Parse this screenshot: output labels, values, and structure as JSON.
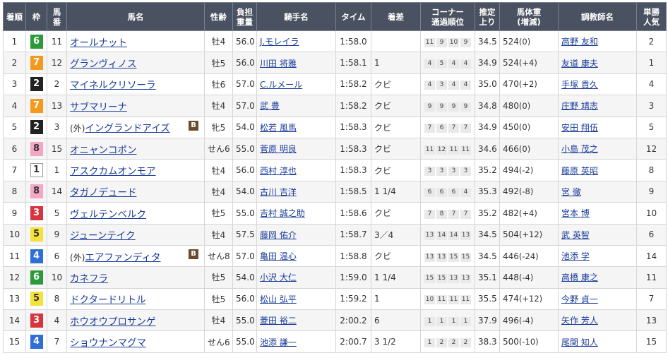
{
  "headers": {
    "rank": "着順",
    "waku": "枠",
    "umaban": "馬\n番",
    "horse": "馬名",
    "sexage": "性齢",
    "burden": "負担\n重量",
    "jockey": "騎手名",
    "time": "タイム",
    "margin": "着差",
    "corner": "コーナー\n通過順位",
    "last3f": "推定\n上り",
    "bodyweight": "馬体重\n(増減)",
    "trainer": "調教師名",
    "pop": "単勝\n人気"
  },
  "rows": [
    {
      "rank": "1",
      "waku": "6",
      "umaban": "11",
      "maru": "",
      "horse": "オールナット",
      "blinker": "",
      "sexage": "牡4",
      "burden": "56.0",
      "jockey": "J.モレイラ",
      "time": "1:58.0",
      "margin": "",
      "corner": [
        "11",
        "9",
        "10",
        "9"
      ],
      "last3f": "34.5",
      "bw": "524",
      "bwd": "(0)",
      "trainer": "高野 友和",
      "pop": "2"
    },
    {
      "rank": "2",
      "waku": "7",
      "umaban": "12",
      "maru": "",
      "horse": "グランヴィノス",
      "blinker": "",
      "sexage": "牡5",
      "burden": "56.0",
      "jockey": "川田 将雅",
      "time": "1:58.1",
      "margin": "1",
      "corner": [
        "4",
        "5",
        "4",
        "4"
      ],
      "last3f": "34.9",
      "bw": "524",
      "bwd": "(+4)",
      "trainer": "友道 康夫",
      "pop": "1"
    },
    {
      "rank": "3",
      "waku": "2",
      "umaban": "2",
      "maru": "",
      "horse": "マイネルクリソーラ",
      "blinker": "",
      "sexage": "牡6",
      "burden": "57.0",
      "jockey": "C.ルメール",
      "time": "1:58.2",
      "margin": "クビ",
      "corner": [
        "4",
        "3",
        "4",
        "4"
      ],
      "last3f": "35.0",
      "bw": "470",
      "bwd": "(+2)",
      "trainer": "手塚 貴久",
      "pop": "4"
    },
    {
      "rank": "4",
      "waku": "7",
      "umaban": "13",
      "maru": "",
      "horse": "サブマリーナ",
      "blinker": "",
      "sexage": "牡4",
      "burden": "57.0",
      "jockey": "武 豊",
      "time": "1:58.2",
      "margin": "クビ",
      "corner": [
        "9",
        "9",
        "9",
        "9"
      ],
      "last3f": "34.8",
      "bw": "480",
      "bwd": "(0)",
      "trainer": "庄野 靖志",
      "pop": "3"
    },
    {
      "rank": "5",
      "waku": "2",
      "umaban": "3",
      "maru": "外",
      "horse": "イングランドアイズ",
      "blinker": "B",
      "sexage": "牝5",
      "burden": "54.0",
      "jockey": "松若 風馬",
      "time": "1:58.3",
      "margin": "クビ",
      "corner": [
        "7",
        "6",
        "7",
        "7"
      ],
      "last3f": "34.9",
      "bw": "450",
      "bwd": "(0)",
      "trainer": "安田 翔伍",
      "pop": "5"
    },
    {
      "rank": "6",
      "waku": "8",
      "umaban": "15",
      "maru": "",
      "horse": "オニャンコポン",
      "blinker": "",
      "sexage": "せん6",
      "burden": "55.0",
      "jockey": "菅原 明良",
      "time": "1:58.3",
      "margin": "クビ",
      "corner": [
        "11",
        "12",
        "11",
        "11"
      ],
      "last3f": "34.6",
      "bw": "466",
      "bwd": "(0)",
      "trainer": "小島 茂之",
      "pop": "12"
    },
    {
      "rank": "7",
      "waku": "1",
      "umaban": "1",
      "maru": "",
      "horse": "アスクカムオンモア",
      "blinker": "",
      "sexage": "牡4",
      "burden": "56.0",
      "jockey": "西村 淳也",
      "time": "1:58.3",
      "margin": "クビ",
      "corner": [
        "3",
        "3",
        "3",
        "3"
      ],
      "last3f": "35.2",
      "bw": "494",
      "bwd": "(-2)",
      "trainer": "藤原 英昭",
      "pop": "8"
    },
    {
      "rank": "8",
      "waku": "8",
      "umaban": "14",
      "maru": "",
      "horse": "タガノデュード",
      "blinker": "",
      "sexage": "牡4",
      "burden": "54.0",
      "jockey": "古川 吉洋",
      "time": "1:58.5",
      "margin": "1 1/4",
      "corner": [
        "6",
        "6",
        "6",
        "4"
      ],
      "last3f": "35.3",
      "bw": "492",
      "bwd": "(-8)",
      "trainer": "宮 徹",
      "pop": "9"
    },
    {
      "rank": "9",
      "waku": "3",
      "umaban": "5",
      "maru": "",
      "horse": "ヴェルテンベルク",
      "blinker": "",
      "sexage": "牡5",
      "burden": "55.0",
      "jockey": "吉村 誠之助",
      "time": "1:58.6",
      "margin": "クビ",
      "corner": [
        "7",
        "8",
        "7",
        "7"
      ],
      "last3f": "35.2",
      "bw": "482",
      "bwd": "(+4)",
      "trainer": "宮本 博",
      "pop": "10"
    },
    {
      "rank": "10",
      "waku": "5",
      "umaban": "9",
      "maru": "",
      "horse": "ジューンテイク",
      "blinker": "",
      "sexage": "牡4",
      "burden": "57.5",
      "jockey": "藤岡 佑介",
      "time": "1:58.7",
      "margin": "3／4",
      "corner": [
        "13",
        "14",
        "14",
        "13"
      ],
      "last3f": "34.5",
      "bw": "504",
      "bwd": "(+12)",
      "trainer": "武 英智",
      "pop": "6"
    },
    {
      "rank": "11",
      "waku": "4",
      "umaban": "6",
      "maru": "外",
      "horse": "エアファンディタ",
      "blinker": "B",
      "sexage": "せん8",
      "burden": "57.0",
      "jockey": "亀田 温心",
      "time": "1:58.8",
      "margin": "クビ",
      "corner": [
        "13",
        "13",
        "15",
        "15"
      ],
      "last3f": "34.5",
      "bw": "446",
      "bwd": "(-24)",
      "trainer": "池添 学",
      "pop": "14"
    },
    {
      "rank": "12",
      "waku": "6",
      "umaban": "10",
      "maru": "",
      "horse": "カネフラ",
      "blinker": "",
      "sexage": "牡5",
      "burden": "54.0",
      "jockey": "小沢 大仁",
      "time": "1:59.0",
      "margin": "1 1/4",
      "corner": [
        "15",
        "15",
        "13",
        "13"
      ],
      "last3f": "35.1",
      "bw": "448",
      "bwd": "(-4)",
      "trainer": "高橋 康之",
      "pop": "11"
    },
    {
      "rank": "13",
      "waku": "5",
      "umaban": "8",
      "maru": "",
      "horse": "ドクタードリトル",
      "blinker": "",
      "sexage": "牡5",
      "burden": "56.0",
      "jockey": "松山 弘平",
      "time": "1:59.2",
      "margin": "1",
      "corner": [
        "10",
        "11",
        "11",
        "11"
      ],
      "last3f": "35.5",
      "bw": "474",
      "bwd": "(+12)",
      "trainer": "今野 貞一",
      "pop": "7"
    },
    {
      "rank": "14",
      "waku": "3",
      "umaban": "4",
      "maru": "",
      "horse": "ホウオウプロサンゲ",
      "blinker": "",
      "sexage": "牡4",
      "burden": "55.0",
      "jockey": "菱田 裕二",
      "time": "2:00.2",
      "margin": "6",
      "corner": [
        "1",
        "1",
        "1",
        "1"
      ],
      "last3f": "37.9",
      "bw": "496",
      "bwd": "(-4)",
      "trainer": "矢作 芳人",
      "pop": "13"
    },
    {
      "rank": "15",
      "waku": "4",
      "umaban": "7",
      "maru": "",
      "horse": "ショウナンマグマ",
      "blinker": "",
      "sexage": "せん6",
      "burden": "55.0",
      "jockey": "池添 謙一",
      "time": "2:00.7",
      "margin": "3 1/2",
      "corner": [
        "1",
        "2",
        "2",
        "2"
      ],
      "last3f": "38.3",
      "bw": "500",
      "bwd": "(-10)",
      "trainer": "尾関 知人",
      "pop": "15"
    }
  ]
}
